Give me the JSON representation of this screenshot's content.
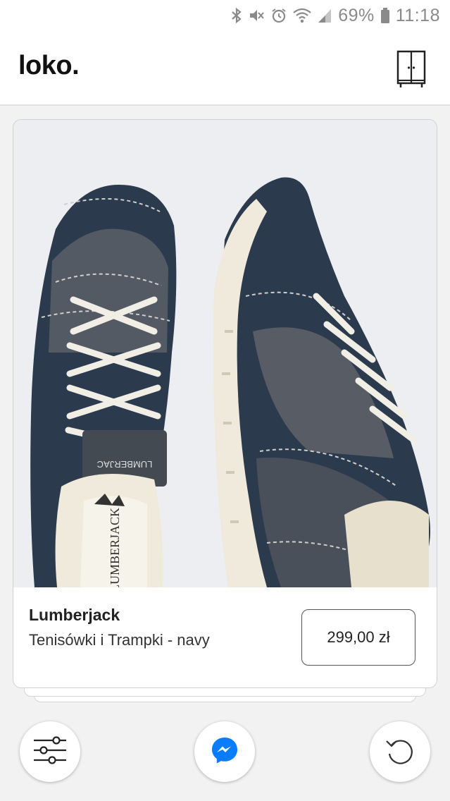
{
  "status_bar": {
    "battery_percent": "69%",
    "time": "11:18",
    "icons": [
      "bluetooth-icon",
      "mute-icon",
      "alarm-icon",
      "wifi-icon",
      "signal-icon",
      "battery-icon"
    ]
  },
  "header": {
    "logo": "loko.",
    "wardrobe_icon": "wardrobe-icon"
  },
  "product": {
    "brand": "Lumberjack",
    "name": "Tenisówki i Trampki - navy",
    "price": "299,00 zł",
    "image_print_a": "LUMBERJAC",
    "image_print_b": "LUMBERJACK"
  },
  "bottom_actions": {
    "filter_icon": "sliders-icon",
    "messenger_icon": "messenger-icon",
    "undo_icon": "undo-icon"
  },
  "colors": {
    "accent_blue": "#0a7cff",
    "shoe_navy": "#2b3a4c",
    "sole_cream": "#efeadb"
  }
}
